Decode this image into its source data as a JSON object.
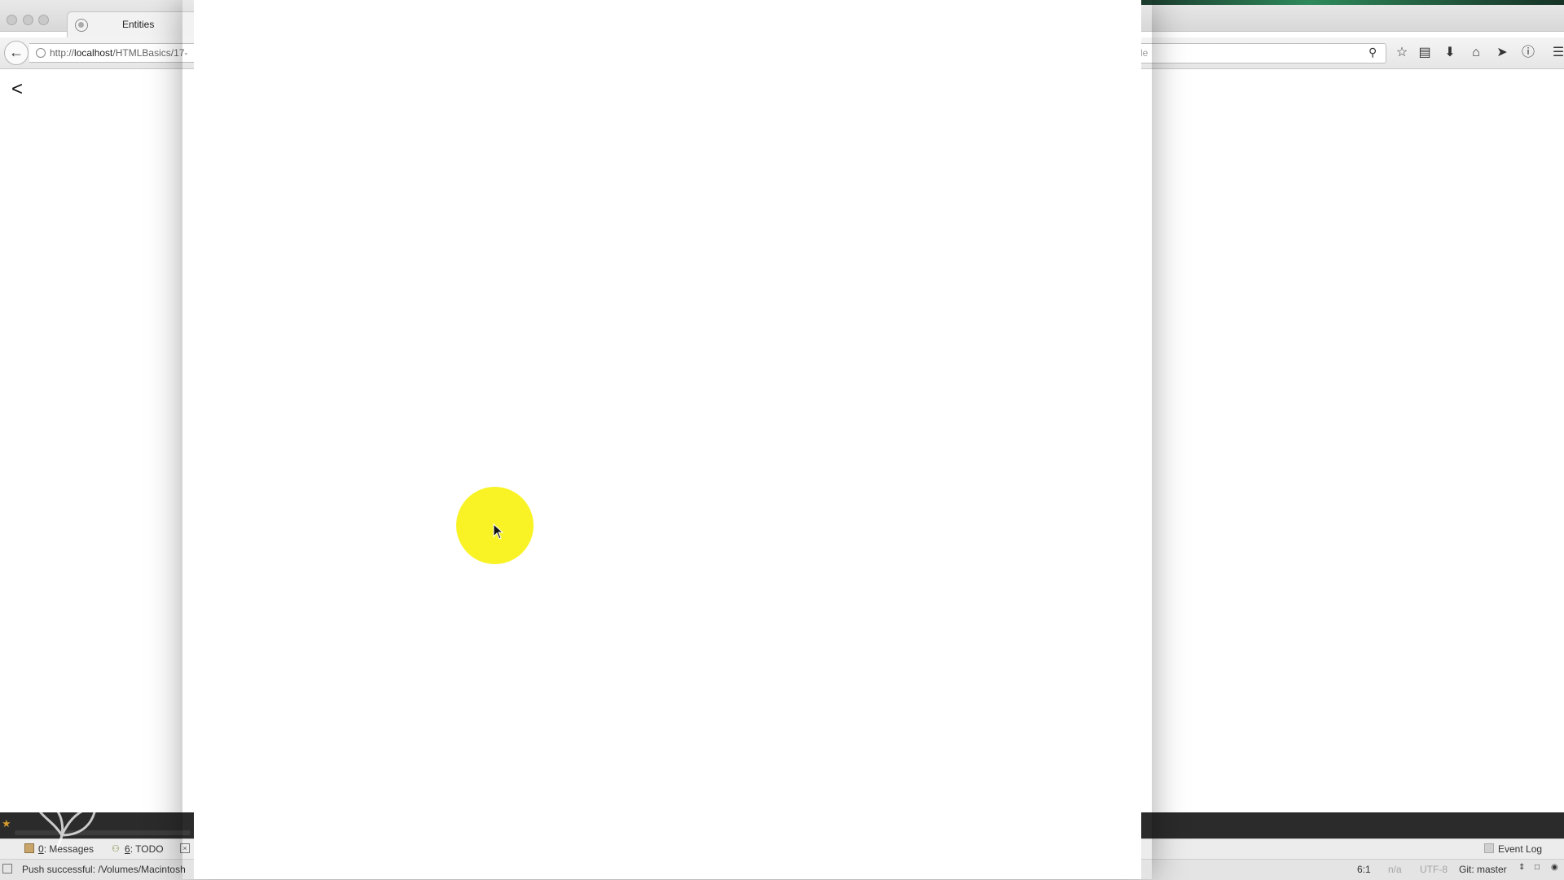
{
  "browser": {
    "tab_title": "Entities",
    "url_prefix": "http://",
    "url_host": "localhost",
    "url_path": "/HTMLBasics/17-",
    "search_text": "le",
    "page_content": "<"
  },
  "ide": {
    "tool_windows": {
      "messages_num": "0",
      "messages_label": ": Messages",
      "todo_num": "6",
      "todo_label": ": TODO",
      "event_log": "Event Log"
    },
    "status": {
      "message": "Push successful: /Volumes/Macintosh",
      "position": "6:1",
      "na": "n/a",
      "encoding": "UTF-8",
      "vcs": "Git: master"
    }
  },
  "icons": {
    "back": "back-arrow-icon",
    "site": "globe-icon",
    "search": "search-icon",
    "bookmark": "star-icon",
    "reading_list": "clipboard-icon",
    "download": "download-icon",
    "home": "home-icon",
    "send": "send-icon",
    "info": "info-icon",
    "menu": "menu-icon"
  },
  "colors": {
    "cursor_highlight": "#f9f21a",
    "ide_dark": "#2b2b2b"
  }
}
